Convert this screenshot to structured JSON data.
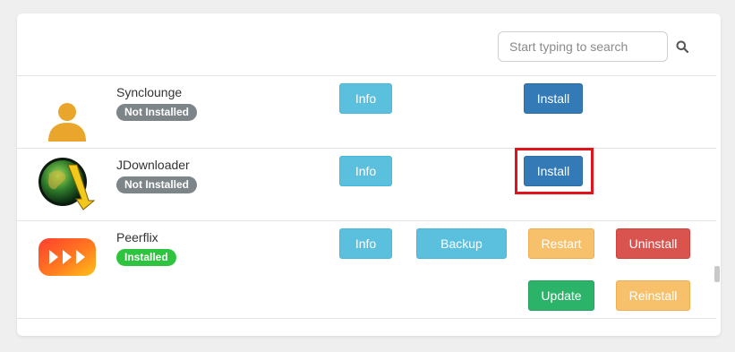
{
  "search": {
    "placeholder": "Start typing to search",
    "icon": "search-icon"
  },
  "apps": [
    {
      "name": "Synclounge",
      "status": "Not Installed",
      "icon": "user-avatar-icon",
      "buttons": {
        "info": "Info",
        "install": "Install"
      }
    },
    {
      "name": "JDownloader",
      "status": "Not Installed",
      "icon": "jdownloader-globe-icon",
      "buttons": {
        "info": "Info",
        "install": "Install"
      }
    },
    {
      "name": "Peerflix",
      "status": "Installed",
      "icon": "play-arrows-icon",
      "buttons": {
        "info": "Info",
        "backup": "Backup",
        "restart": "Restart",
        "uninstall": "Uninstall",
        "update": "Update",
        "reinstall": "Reinstall"
      }
    }
  ],
  "colors": {
    "info": "#5bc0de",
    "primary": "#337ab7",
    "warning": "#f7c06b",
    "danger": "#d9534f",
    "success": "#2cb36a",
    "badge_not_installed": "#7d8589",
    "badge_installed": "#2ec43f",
    "highlight": "#e0121c"
  }
}
